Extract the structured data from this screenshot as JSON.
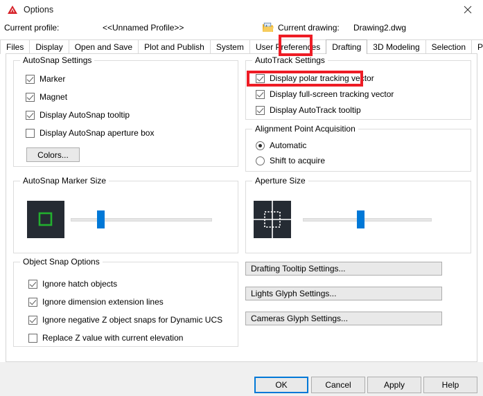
{
  "window": {
    "title": "Options",
    "app_icon": "autocad-logo-icon",
    "close_icon": "close-icon"
  },
  "header": {
    "profile_label": "Current profile:",
    "profile_value": "<<Unnamed Profile>>",
    "drawing_icon": "drawing-file-icon",
    "drawing_label": "Current drawing:",
    "drawing_value": "Drawing2.dwg"
  },
  "tabs": [
    {
      "label": "Files",
      "active": false
    },
    {
      "label": "Display",
      "active": false
    },
    {
      "label": "Open and Save",
      "active": false
    },
    {
      "label": "Plot and Publish",
      "active": false
    },
    {
      "label": "System",
      "active": false
    },
    {
      "label": "User Preferences",
      "active": false
    },
    {
      "label": "Drafting",
      "active": true
    },
    {
      "label": "3D Modeling",
      "active": false
    },
    {
      "label": "Selection",
      "active": false
    },
    {
      "label": "Profiles",
      "active": false
    }
  ],
  "autosnap_settings": {
    "title": "AutoSnap Settings",
    "items": [
      {
        "label": "Marker",
        "checked": true
      },
      {
        "label": "Magnet",
        "checked": true
      },
      {
        "label": "Display AutoSnap tooltip",
        "checked": true
      },
      {
        "label": "Display AutoSnap aperture box",
        "checked": false
      }
    ],
    "colors_button": "Colors..."
  },
  "autotrack_settings": {
    "title": "AutoTrack Settings",
    "items": [
      {
        "label": "Display polar tracking vector",
        "checked": true
      },
      {
        "label": "Display full-screen tracking vector",
        "checked": true
      },
      {
        "label": "Display AutoTrack tooltip",
        "checked": true
      }
    ]
  },
  "alignment_point_acquisition": {
    "title": "Alignment Point Acquisition",
    "options": [
      {
        "label": "Automatic",
        "selected": true
      },
      {
        "label": "Shift to acquire",
        "selected": false
      }
    ]
  },
  "autosnap_marker_size": {
    "title": "AutoSnap Marker Size",
    "slider_percent": 22,
    "marker_color": "#22b02e",
    "preview_background": "#252b33"
  },
  "aperture_size": {
    "title": "Aperture Size",
    "slider_percent": 47,
    "preview_background": "#252b33"
  },
  "object_snap_options": {
    "title": "Object Snap Options",
    "items": [
      {
        "label": "Ignore hatch objects",
        "checked": true
      },
      {
        "label": "Ignore dimension extension lines",
        "checked": true
      },
      {
        "label": "Ignore negative Z object snaps for Dynamic UCS",
        "checked": true
      },
      {
        "label": "Replace Z value with current elevation",
        "checked": false
      }
    ]
  },
  "side_buttons": [
    {
      "label": "Drafting Tooltip Settings..."
    },
    {
      "label": "Lights Glyph Settings..."
    },
    {
      "label": "Cameras Glyph Settings..."
    }
  ],
  "footer_buttons": [
    {
      "label": "OK",
      "focused": true
    },
    {
      "label": "Cancel",
      "focused": false
    },
    {
      "label": "Apply",
      "focused": false
    },
    {
      "label": "Help",
      "focused": false
    }
  ],
  "annotations": {
    "highlight_color": "#ee1c25",
    "boxes": [
      {
        "target": "tab-drafting"
      },
      {
        "target": "checkbox-display-polar-tracking-vector"
      }
    ]
  }
}
